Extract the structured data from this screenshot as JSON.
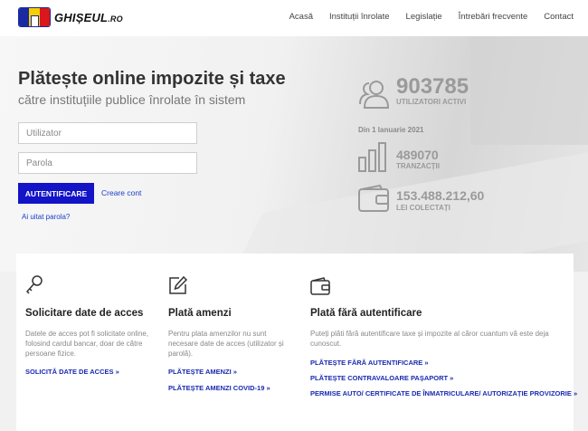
{
  "header": {
    "logo_text": "GHIȘEUL",
    "logo_suffix": ".RO",
    "flag_colors": [
      "#1a2aa0",
      "#f5d000",
      "#d9171c"
    ],
    "nav": [
      "Acasă",
      "Instituții înrolate",
      "Legislație",
      "Întrebări frecvente",
      "Contact"
    ]
  },
  "hero": {
    "title": "Plătește online impozite și taxe",
    "subtitle": "către instituțiile publice înrolate în sistem"
  },
  "login": {
    "user_placeholder": "Utilizator",
    "password_placeholder": "Parola",
    "submit_label": "AUTENTIFICARE",
    "create_account_label": "Creare cont",
    "forgot_label": "Ai uitat parola?"
  },
  "stats": {
    "users": {
      "value": "903785",
      "label": "UTILIZATORI ACTIVI",
      "icon": "users-icon"
    },
    "since": "Din 1 Ianuarie 2021",
    "transactions": {
      "value": "489070",
      "label": "TRANZACȚII",
      "icon": "bar-chart-icon"
    },
    "collected": {
      "value": "153.488.212,60",
      "label": "LEI COLECTAȚI",
      "icon": "wallet-icon"
    }
  },
  "cards": [
    {
      "icon": "key-icon",
      "title": "Solicitare date de acces",
      "description": "Datele de acces pot fi solicitate online, folosind cardul bancar, doar de către persoane fizice.",
      "links": [
        "SOLICITĂ DATE DE ACCES »"
      ]
    },
    {
      "icon": "edit-icon",
      "title": "Plată amenzi",
      "description": "Pentru plata amenzilor nu sunt necesare date de acces (utilizator și parolă).",
      "links": [
        "PLĂTEȘTE AMENZI »",
        "PLĂTEȘTE AMENZI COVID-19 »"
      ]
    },
    {
      "icon": "wallet-icon",
      "title": "Plată fără autentificare",
      "description": "Puteți plăti fără autentificare taxe și impozite al căror cuantum vă este deja cunoscut.",
      "links": [
        "PLĂTEȘTE FĂRĂ AUTENTIFICARE »",
        "PLĂTEȘTE CONTRAVALOARE PAȘAPORT »",
        "PERMISE AUTO/ CERTIFICATE DE ÎNMATRICULARE/ AUTORIZAȚIE PROVIZORIE »"
      ]
    }
  ]
}
